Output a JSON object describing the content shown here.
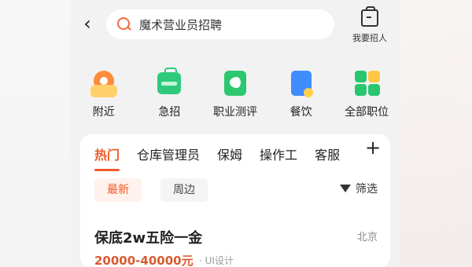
{
  "header": {
    "search_text": "魔术营业员招聘",
    "post_label": "我要招人"
  },
  "quick_links": [
    {
      "label": "附近",
      "icon": "map-pin-icon"
    },
    {
      "label": "急招",
      "icon": "briefcase-icon"
    },
    {
      "label": "职业测评",
      "icon": "assessment-icon"
    },
    {
      "label": "餐饮",
      "icon": "food-book-icon"
    },
    {
      "label": "全部职位",
      "icon": "grid-icon"
    }
  ],
  "tabs": [
    {
      "label": "热门",
      "active": true
    },
    {
      "label": "仓库管理员"
    },
    {
      "label": "保姆"
    },
    {
      "label": "操作工"
    },
    {
      "label": "客服"
    }
  ],
  "filters": {
    "chip_active": "最新",
    "chip_plain": "周边",
    "filter_label": "筛选"
  },
  "job": {
    "title": "保底2w五险一金",
    "city": "北京",
    "salary": "20000-40000元",
    "tag": "· UI设计"
  },
  "colors": {
    "accent": "#f05a2a",
    "bg": "#f2f2f2"
  }
}
